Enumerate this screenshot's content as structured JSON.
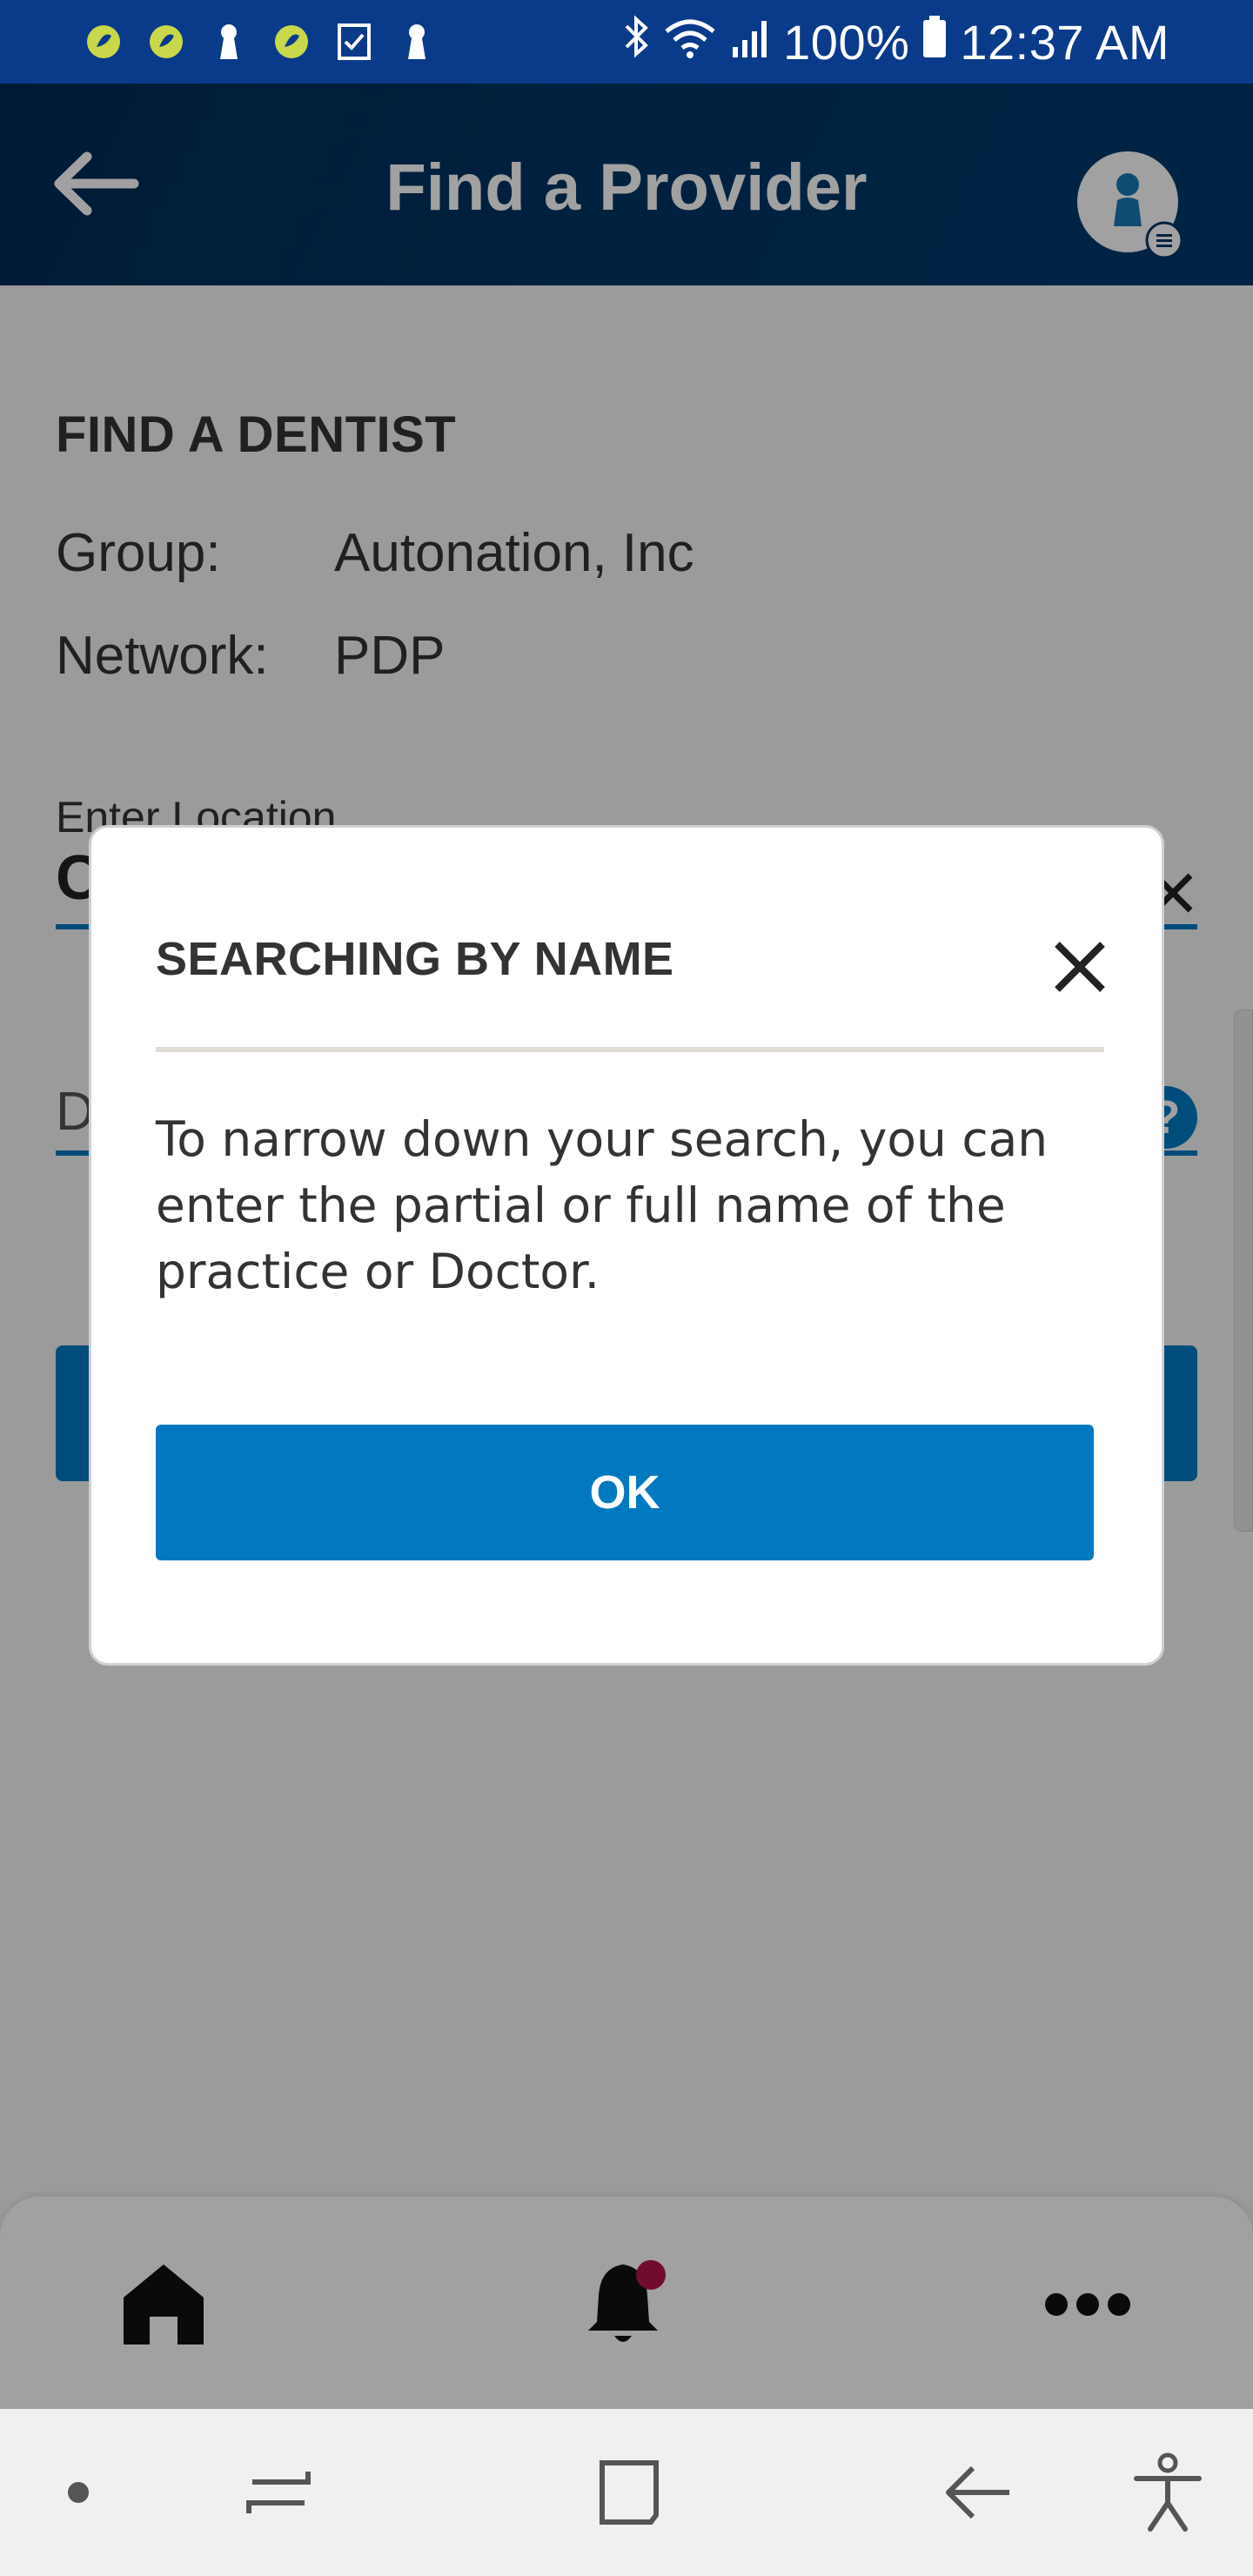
{
  "status_bar": {
    "battery": "100%",
    "time": "12:37 AM",
    "left_icons": [
      "app-leaf-icon",
      "app-leaf-icon",
      "keyhole-icon",
      "app-leaf-icon",
      "checklist-icon",
      "keyhole-icon"
    ],
    "right_icons": [
      "bluetooth-icon",
      "wifi-icon",
      "signal-icon",
      "battery-icon"
    ]
  },
  "header": {
    "title": "Find a Provider",
    "back_icon": "arrow-left-icon",
    "profile_icon": "user-menu-icon"
  },
  "page": {
    "section_title": "FIND A DENTIST",
    "group_label": "Group:",
    "group_value": "Autonation, Inc",
    "network_label": "Network:",
    "network_value": "PDP",
    "location_label": "Enter Location",
    "location_value_partial": "C",
    "name_field_partial": "D"
  },
  "modal": {
    "title": "SEARCHING BY NAME",
    "body": "To narrow down your search, you can enter the partial or full name of the practice or Doctor.",
    "ok_label": "OK"
  },
  "bottom_nav": {
    "items": [
      "home-icon",
      "notification-bell-icon",
      "more-dots-icon"
    ],
    "notification_badge_color": "#b3144a"
  },
  "colors": {
    "status_bar": "#0a3a8a",
    "header": "#003766",
    "accent": "#0079c1",
    "overlay": "rgba(0,0,0,0.37)"
  }
}
